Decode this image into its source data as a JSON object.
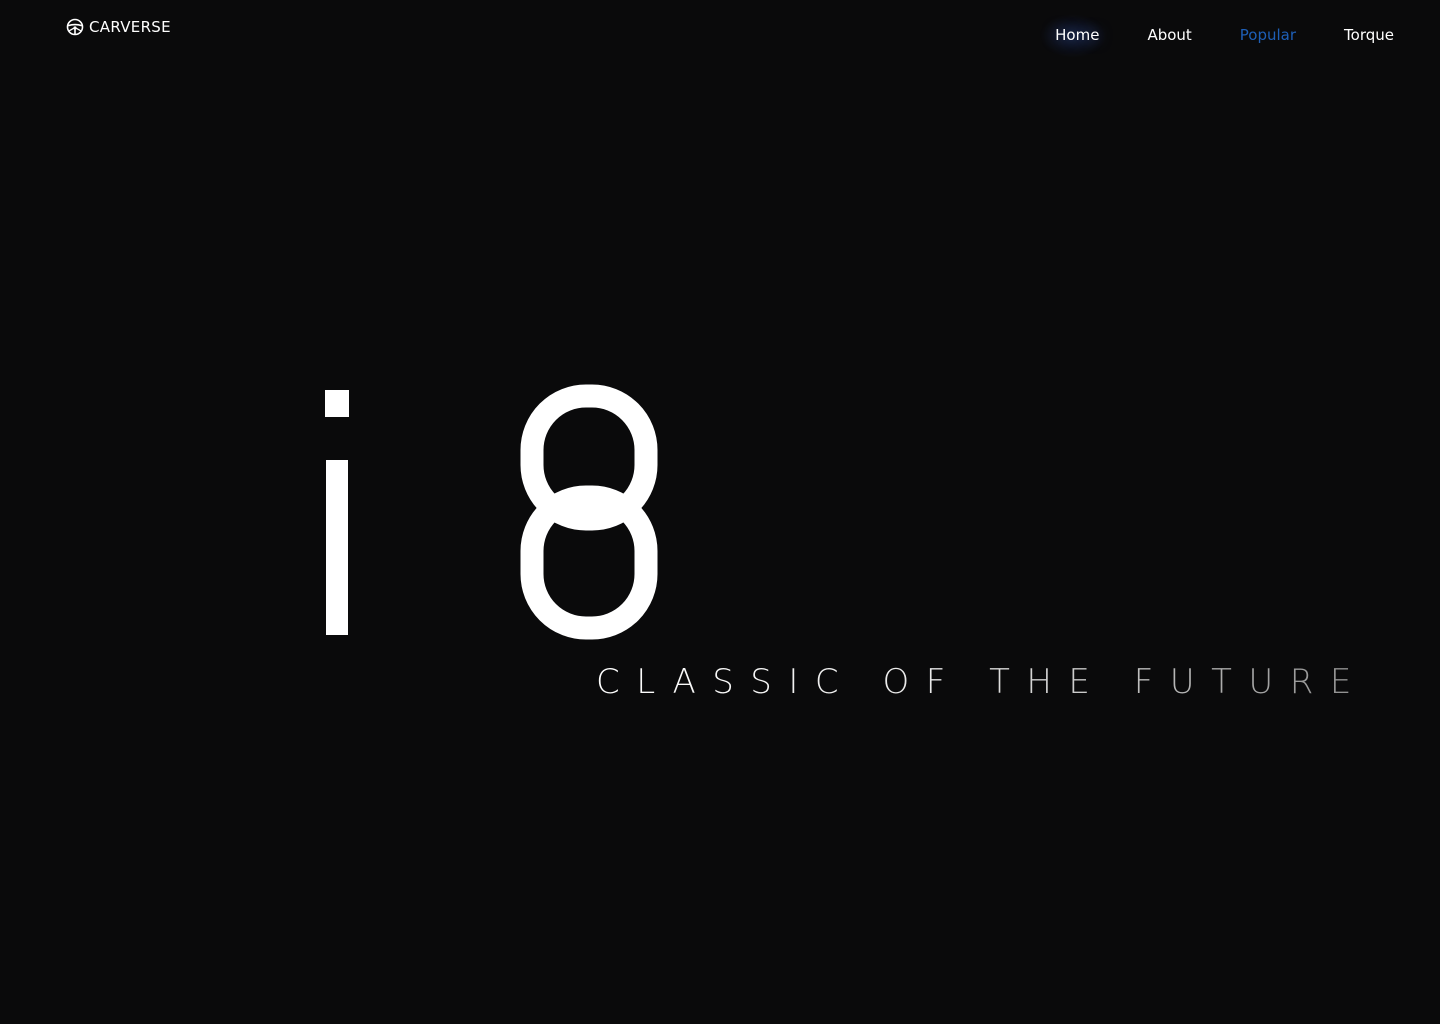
{
  "header": {
    "brand": "CARVERSE",
    "logo_icon": "steering-wheel-icon"
  },
  "nav": {
    "items": [
      {
        "label": "Home",
        "state": "hover"
      },
      {
        "label": "About",
        "state": "default"
      },
      {
        "label": "Popular",
        "state": "active"
      },
      {
        "label": "Torque",
        "state": "default"
      }
    ],
    "active_color": "#1e5fb7"
  },
  "hero": {
    "model": "i8",
    "tagline": "CLASSIC OF THE FUTURE"
  },
  "colors": {
    "background": "#0a0a0b",
    "text": "#ffffff"
  }
}
